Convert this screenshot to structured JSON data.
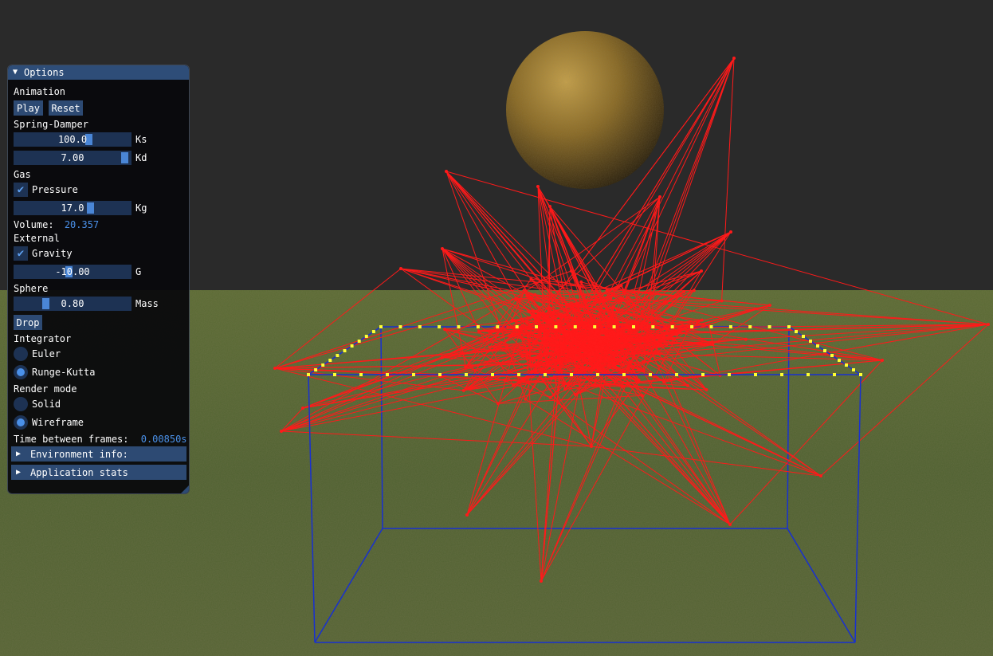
{
  "panel": {
    "title": "Options",
    "title_icon": "triangle-down-icon",
    "sections": {
      "animation": "Animation",
      "spring_damper": "Spring-Damper",
      "gas": "Gas",
      "external": "External",
      "sphere": "Sphere",
      "integrator": "Integrator",
      "render_mode": "Render mode"
    },
    "buttons": {
      "play": "Play",
      "reset": "Reset",
      "drop": "Drop"
    },
    "sliders": {
      "ks": {
        "value": "100.0",
        "label": "Ks",
        "level": 0.65
      },
      "kd": {
        "value": "7.00",
        "label": "Kd",
        "level": 0.97
      },
      "kg": {
        "value": "17.0",
        "label": "Kg",
        "level": 0.66
      },
      "g": {
        "value": "-10.00",
        "label": "G",
        "level": 0.47
      },
      "mass": {
        "value": "0.80",
        "label": "Mass",
        "level": 0.26
      }
    },
    "checks": {
      "pressure": {
        "label": "Pressure",
        "checked": true
      },
      "gravity": {
        "label": "Gravity",
        "checked": true
      }
    },
    "volume": {
      "label": "Volume:",
      "value": "20.357"
    },
    "integrator_options": [
      {
        "label": "Euler",
        "selected": false
      },
      {
        "label": "Runge-Kutta",
        "selected": true
      }
    ],
    "render_options": [
      {
        "label": "Solid",
        "selected": false
      },
      {
        "label": "Wireframe",
        "selected": true
      }
    ],
    "frame_time": {
      "label": "Time between frames:",
      "value": "0.00850s"
    },
    "collapsibles": {
      "environment": "Environment info:",
      "app_stats": "Application stats"
    }
  },
  "colors": {
    "sky": "#2a2a2a",
    "ground": "#4b5c2d",
    "sphere": "#8a6a22",
    "wire": "#ff1a1a",
    "box": "#1830d0",
    "surface_points": "#ffff33",
    "panel_title": "#2e4d78",
    "accent": "#4a90e8"
  }
}
